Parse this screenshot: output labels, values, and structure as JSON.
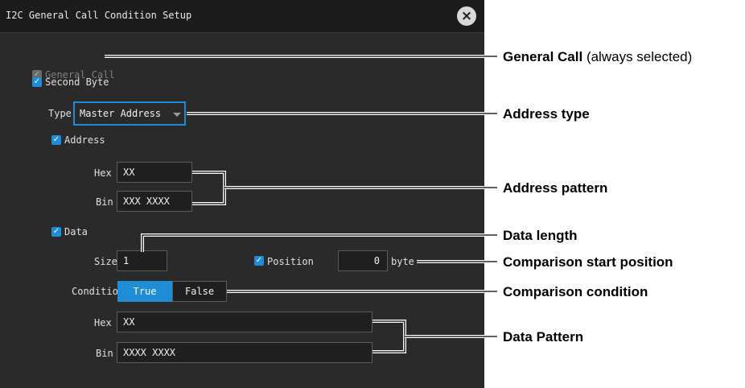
{
  "dialog": {
    "title": "I2C General Call Condition Setup",
    "close_icon": "close-circle-icon"
  },
  "general_call": {
    "label": "General Call",
    "checked": true,
    "enabled": false
  },
  "second_byte": {
    "label": "Second Byte",
    "checked": true
  },
  "type": {
    "label": "Type",
    "selected": "Master Address"
  },
  "address": {
    "label": "Address",
    "checked": true,
    "hex_label": "Hex",
    "hex_value": "XX",
    "bin_label": "Bin",
    "bin_value": "XXX XXXX"
  },
  "data": {
    "label": "Data",
    "checked": true,
    "size_label": "Size",
    "size_value": "1",
    "position_label": "Position",
    "position_checked": true,
    "position_value": "0",
    "position_unit": "byte",
    "condition_label": "Condition",
    "condition_options": [
      "True",
      "False"
    ],
    "condition_selected": "True",
    "hex_label": "Hex",
    "hex_value": "XX",
    "bin_label": "Bin",
    "bin_value": "XXXX XXXX"
  },
  "callouts": {
    "general_call_bold": "General Call",
    "general_call_rest": " (always selected)",
    "address_type": "Address type",
    "address_pattern": "Address pattern",
    "data_length": "Data length",
    "comparison_start": "Comparison start position",
    "comparison_condition": "Comparison condition",
    "data_pattern": "Data Pattern"
  },
  "colors": {
    "accent": "#1f8dd6",
    "dialog_bg": "#2a2a2a",
    "field_bg": "#1f1f1f"
  }
}
